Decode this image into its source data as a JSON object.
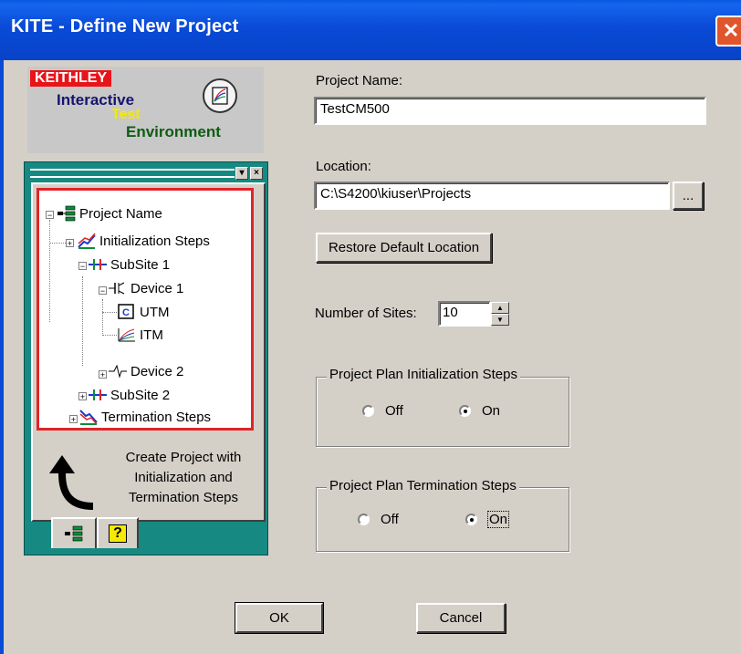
{
  "window": {
    "title": "KITE - Define New Project",
    "close_glyph": "✕"
  },
  "logo": {
    "brand": "KEITHLEY",
    "line1": "Interactive",
    "line2": "Test",
    "line3": "Environment"
  },
  "tree": {
    "items": [
      {
        "label": "Project Name",
        "icon": "project-icon"
      },
      {
        "label": "Initialization Steps",
        "icon": "init-steps-icon"
      },
      {
        "label": "SubSite 1",
        "icon": "subsite-icon"
      },
      {
        "label": "Device 1",
        "icon": "device-icon"
      },
      {
        "label": "UTM",
        "icon": "utm-icon"
      },
      {
        "label": "ITM",
        "icon": "itm-icon"
      },
      {
        "label": "Device 2",
        "icon": "device-icon"
      },
      {
        "label": "SubSite 2",
        "icon": "subsite-icon"
      },
      {
        "label": "Termination Steps",
        "icon": "termination-steps-icon"
      }
    ],
    "hint": "Create Project with Initialization and Termination Steps"
  },
  "tabs": [
    {
      "glyph": "⫶"
    },
    {
      "glyph": "?"
    }
  ],
  "form": {
    "project_name_label": "Project Name:",
    "project_name_value": "TestCM500",
    "location_label": "Location:",
    "location_value": "C:\\S4200\\kiuser\\Projects",
    "browse_label": "...",
    "restore_label": "Restore Default Location",
    "sites_label": "Number of Sites:",
    "sites_value": "10",
    "init_group_label": "Project Plan Initialization Steps",
    "term_group_label": "Project Plan Termination Steps",
    "off_label": "Off",
    "on_label": "On",
    "init_selected": "On",
    "term_selected": "On"
  },
  "footer": {
    "ok_label": "OK",
    "cancel_label": "Cancel"
  },
  "colors": {
    "title_bar": "#0a4ad6",
    "tree_border": "#e0242a",
    "dock_panel": "#168a82"
  }
}
